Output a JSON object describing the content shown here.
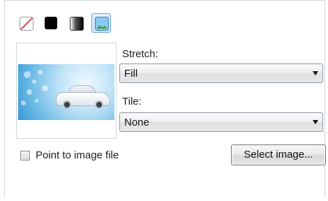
{
  "fill_options": [
    {
      "icon": "no-fill-icon",
      "selected": false
    },
    {
      "icon": "solid-fill-icon",
      "selected": false
    },
    {
      "icon": "gradient-fill-icon",
      "selected": false
    },
    {
      "icon": "image-fill-icon",
      "selected": true
    }
  ],
  "stretch": {
    "label": "Stretch:",
    "value": "Fill"
  },
  "tile": {
    "label": "Tile:",
    "value": "None"
  },
  "point_to_file": {
    "label": "Point to image file",
    "checked": false
  },
  "select_image": {
    "label": "Select image..."
  },
  "colors": {
    "accent_border": "#6fa3d9",
    "accent_fill": "#cfe3fa",
    "no_fill_slash": "#e04646"
  }
}
